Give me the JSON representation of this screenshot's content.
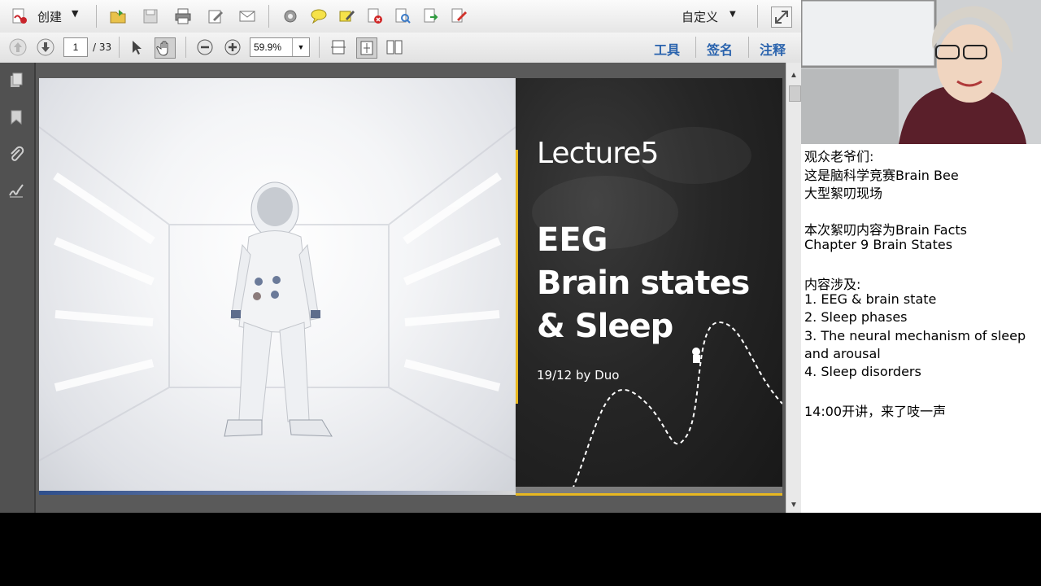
{
  "toolbar": {
    "create_label": "创建",
    "customize_label": "自定义",
    "tools_label": "工具",
    "sign_label": "签名",
    "comment_label": "注释"
  },
  "nav": {
    "page_current": "1",
    "page_total": "/ 33",
    "zoom": "59.9%"
  },
  "slide": {
    "title": "Lecture5",
    "heading_line1": "EEG",
    "heading_line2": "Brain states",
    "heading_line3": "& Sleep",
    "byline": "19/12 by Duo"
  },
  "chat": {
    "lines": [
      "观众老爷们:",
      "这是脑科学竞赛Brain Bee",
      "大型絮叨现场",
      "",
      "本次絮叨内容为Brain Facts",
      "Chapter 9 Brain States",
      "",
      "内容涉及:",
      " 1. EEG & brain state",
      " 2. Sleep phases",
      " 3. The neural mechanism of sleep",
      "and arousal",
      " 4. Sleep disorders",
      "",
      "14:00开讲，来了吱一声"
    ]
  },
  "colors": {
    "accent_yellow": "#e8b820",
    "link_blue": "#2a63ad"
  }
}
